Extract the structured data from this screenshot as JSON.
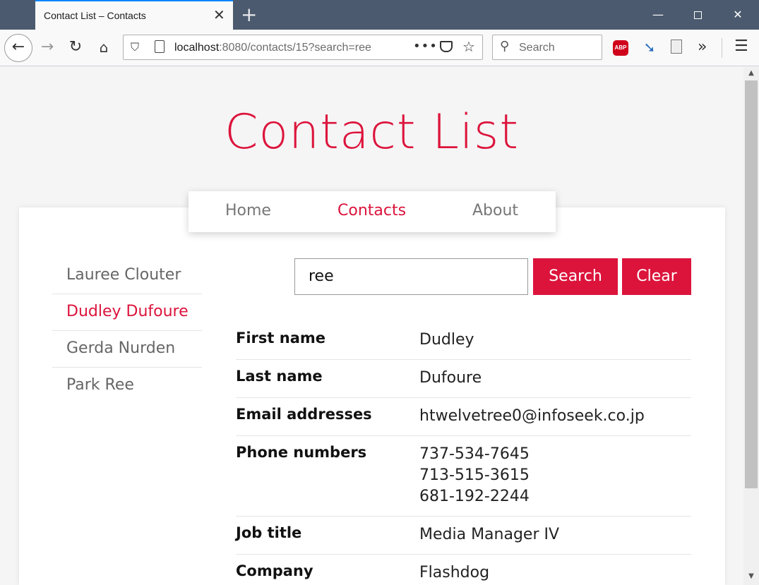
{
  "browser": {
    "tab_title": "Contact List – Contacts",
    "tab_close": "✕",
    "new_tab": "+",
    "url_host": "localhost",
    "url_rest": ":8080/contacts/15?search=ree",
    "search_placeholder": "Search",
    "abp_label": "ABP"
  },
  "page": {
    "title": "Contact List"
  },
  "nav": {
    "home": "Home",
    "contacts": "Contacts",
    "about": "About"
  },
  "sidebar": {
    "items": [
      {
        "label": "Lauree Clouter"
      },
      {
        "label": "Dudley Dufoure"
      },
      {
        "label": "Gerda Nurden"
      },
      {
        "label": "Park Ree"
      }
    ]
  },
  "search": {
    "value": "ree",
    "search_label": "Search",
    "clear_label": "Clear"
  },
  "details": {
    "first_name": {
      "label": "First name",
      "value": "Dudley"
    },
    "last_name": {
      "label": "Last name",
      "value": "Dufoure"
    },
    "email": {
      "label": "Email addresses",
      "value": "htwelvetree0@infoseek.co.jp"
    },
    "phones": {
      "label": "Phone numbers",
      "values": [
        "737-534-7645",
        "713-515-3615",
        "681-192-2244"
      ]
    },
    "job_title": {
      "label": "Job title",
      "value": "Media Manager IV"
    },
    "company": {
      "label": "Company",
      "value": "Flashdog"
    }
  },
  "colors": {
    "accent": "#dc143c",
    "titlebar": "#4b5a6e"
  }
}
